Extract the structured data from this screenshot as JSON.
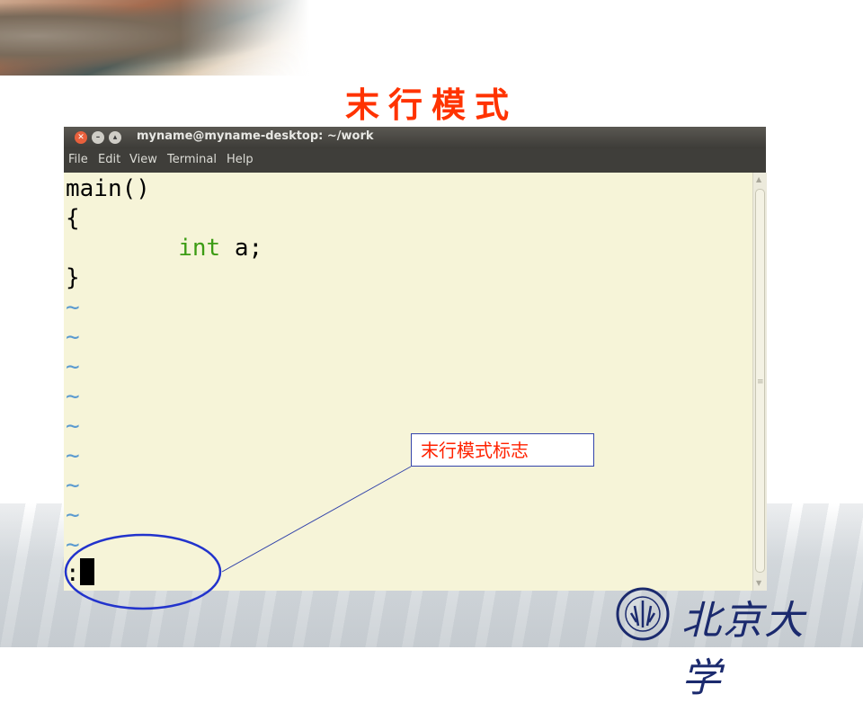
{
  "slide": {
    "title": "末行模式"
  },
  "window": {
    "title": "myname@myname-desktop: ~/work",
    "buttons": [
      "close",
      "minimize",
      "maximize"
    ],
    "menu": [
      "File",
      "Edit",
      "View",
      "Terminal",
      "Help"
    ]
  },
  "editor": {
    "lines": {
      "l1": "main()",
      "l2": "{",
      "l3_indent": "        ",
      "l3_keyword": "int",
      "l3_rest": " a;",
      "l4": "}"
    },
    "tilde": "~",
    "command_prompt": ":",
    "colors": {
      "background": "#f6f4d8",
      "keyword": "#3c9c14",
      "tilde": "#5a9ad0"
    }
  },
  "annotation": {
    "label": "末行模式标志",
    "border_color": "#3344aa",
    "text_color": "#ff2200"
  },
  "logo": {
    "text": "北京大学"
  },
  "colors": {
    "title": "#ff3300"
  }
}
